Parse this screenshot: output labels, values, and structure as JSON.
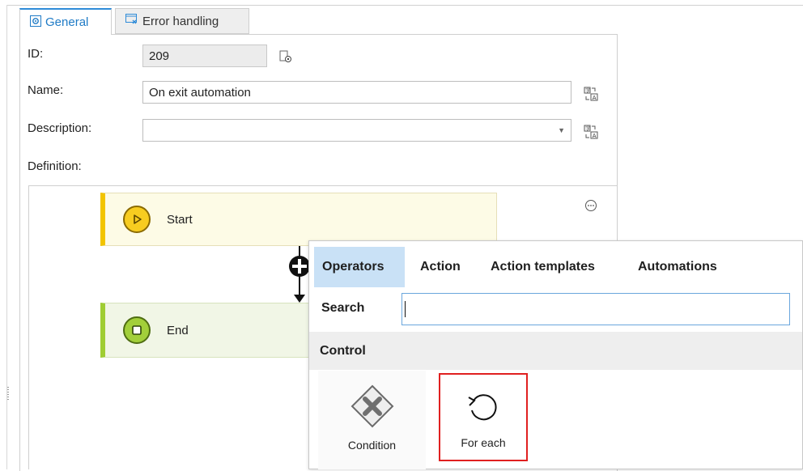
{
  "tabs": [
    {
      "label": "General",
      "active": true,
      "icon": "settings-gear-icon"
    },
    {
      "label": "Error handling",
      "active": false,
      "icon": "error-handling-icon"
    }
  ],
  "form": {
    "id_label": "ID:",
    "id_value": "209",
    "name_label": "Name:",
    "name_value": "On exit automation",
    "description_label": "Description:",
    "description_value": "",
    "definition_label": "Definition:"
  },
  "flow": {
    "start_label": "Start",
    "end_label": "End"
  },
  "picker": {
    "tabs": [
      {
        "label": "Operators",
        "active": true
      },
      {
        "label": "Action",
        "active": false
      },
      {
        "label": "Action templates",
        "active": false
      },
      {
        "label": "Automations",
        "active": false
      }
    ],
    "search_label": "Search",
    "search_value": "",
    "section_title": "Control",
    "items": [
      {
        "label": "Condition",
        "icon": "condition-diamond-icon",
        "highlighted": false
      },
      {
        "label": "For each",
        "icon": "loop-icon",
        "highlighted": true
      }
    ]
  },
  "colors": {
    "accent_blue": "#2e8bd8",
    "start_yellow": "#f2c400",
    "end_green": "#9fcd33",
    "highlight_red": "#e02020",
    "active_tab_bg": "#c9e1f6"
  }
}
